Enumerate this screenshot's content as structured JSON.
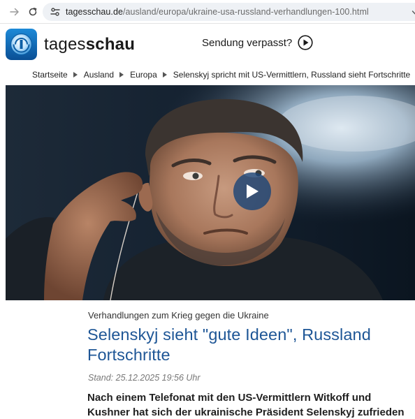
{
  "browser": {
    "url_domain": "tagesschau.de",
    "url_path": "/ausland/europa/ukraine-usa-russland-verhandlungen-100.html"
  },
  "header": {
    "logo_light": "tages",
    "logo_bold": "schau",
    "sendung_label": "Sendung verpasst?"
  },
  "breadcrumb": {
    "items": [
      "Startseite",
      "Ausland",
      "Europa",
      "Selenskyj spricht mit US-Vermittlern, Russland sieht Fortschritte"
    ]
  },
  "article": {
    "kicker": "Verhandlungen zum Krieg gegen die Ukraine",
    "headline": "Selenskyj sieht \"gute Ideen\", Russland Fortschritte",
    "stand": "Stand: 25.12.2025 19:56 Uhr",
    "lead": "Nach einem Telefonat mit den US-Vermittlern Witkoff und Kushner hat sich der ukrainische Präsident Selenskyj zufrieden gezeigt. Auch"
  },
  "icons": {
    "forward": "arrow-right-icon",
    "reload": "reload-icon",
    "site_settings": "tune-icon",
    "sendung_play": "play-circle-icon",
    "video_play": "play-icon"
  },
  "colors": {
    "headline_blue": "#1e5696",
    "logo_blue": "#0b5fa8",
    "video_button": "#1c4678"
  }
}
